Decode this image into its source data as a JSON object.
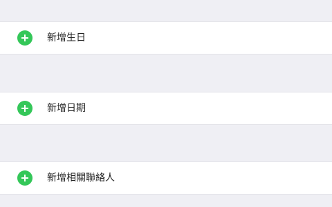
{
  "rows": [
    {
      "label": "新增生日",
      "icon": "add-circle-icon"
    },
    {
      "label": "新增日期",
      "icon": "add-circle-icon"
    },
    {
      "label": "新增相關聯絡人",
      "icon": "add-circle-icon"
    }
  ],
  "colors": {
    "background": "#efeff4",
    "row_background": "#ffffff",
    "add_icon": "#34c759",
    "text": "#222222"
  }
}
